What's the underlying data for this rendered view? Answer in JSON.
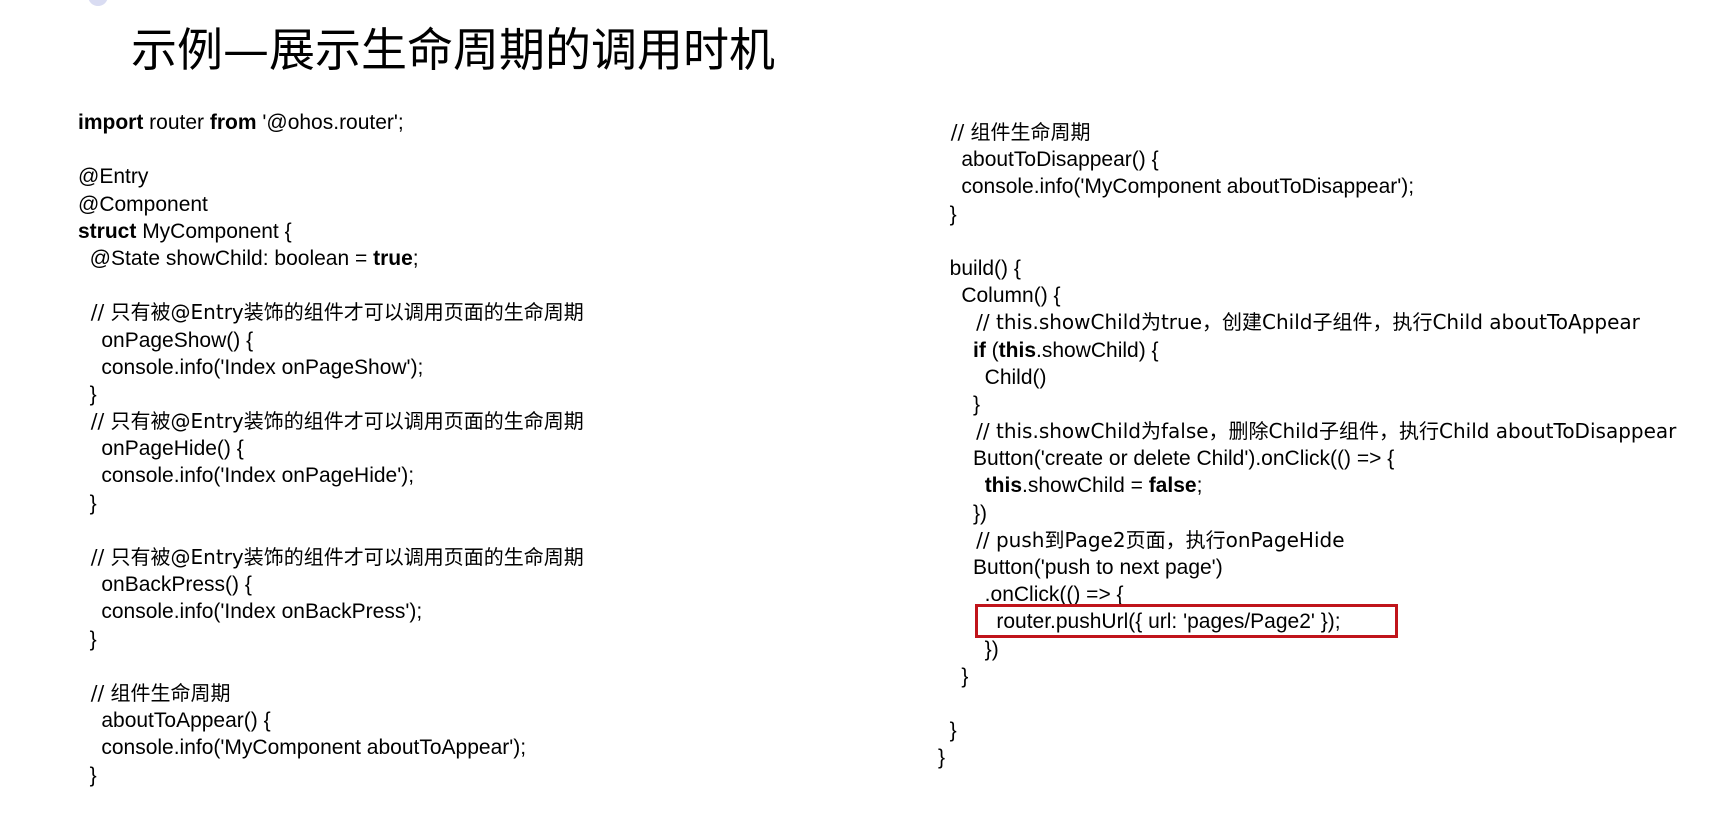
{
  "slide": {
    "title": "示例—展示生命周期的调用时机"
  },
  "code_left": [
    [
      {
        "t": "import",
        "b": true
      },
      {
        "t": " router "
      },
      {
        "t": "from",
        "b": true
      },
      {
        "t": " '@ohos.router';"
      }
    ],
    [],
    [
      {
        "t": "@Entry"
      }
    ],
    [
      {
        "t": "@Component"
      }
    ],
    [
      {
        "t": "struct",
        "b": true
      },
      {
        "t": " MyComponent {"
      }
    ],
    [
      {
        "t": "  @State showChild: boolean = "
      },
      {
        "t": "true",
        "b": true
      },
      {
        "t": ";"
      }
    ],
    [],
    [
      {
        "t": "  // 只有被@Entry装饰的组件才可以调用页面的生命周期",
        "c": true
      }
    ],
    [
      {
        "t": "    onPageShow() {"
      }
    ],
    [
      {
        "t": "    console.info('Index onPageShow');"
      }
    ],
    [
      {
        "t": "  }"
      }
    ],
    [
      {
        "t": "  // 只有被@Entry装饰的组件才可以调用页面的生命周期",
        "c": true
      }
    ],
    [
      {
        "t": "    onPageHide() {"
      }
    ],
    [
      {
        "t": "    console.info('Index onPageHide');"
      }
    ],
    [
      {
        "t": "  }"
      }
    ],
    [],
    [
      {
        "t": "  // 只有被@Entry装饰的组件才可以调用页面的生命周期",
        "c": true
      }
    ],
    [
      {
        "t": "    onBackPress() {"
      }
    ],
    [
      {
        "t": "    console.info('Index onBackPress');"
      }
    ],
    [
      {
        "t": "  }"
      }
    ],
    [],
    [
      {
        "t": "  // 组件生命周期",
        "c": true
      }
    ],
    [
      {
        "t": "    aboutToAppear() {"
      }
    ],
    [
      {
        "t": "    console.info('MyComponent aboutToAppear');"
      }
    ],
    [
      {
        "t": "  }"
      }
    ]
  ],
  "code_right": [
    [
      {
        "t": "  // 组件生命周期",
        "c": true
      }
    ],
    [
      {
        "t": "    aboutToDisappear() {"
      }
    ],
    [
      {
        "t": "    console.info('MyComponent aboutToDisappear');"
      }
    ],
    [
      {
        "t": "  }"
      }
    ],
    [],
    [
      {
        "t": "  build() {"
      }
    ],
    [
      {
        "t": "    Column() {"
      }
    ],
    [
      {
        "t": "      // this.showChild为true，创建Child子组件，执行Child aboutToAppear",
        "c": true
      }
    ],
    [
      {
        "t": "      "
      },
      {
        "t": "if",
        "b": true
      },
      {
        "t": " ("
      },
      {
        "t": "this",
        "b": true
      },
      {
        "t": ".showChild) {"
      }
    ],
    [
      {
        "t": "        Child()"
      }
    ],
    [
      {
        "t": "      }"
      }
    ],
    [
      {
        "t": "      // this.showChild为false，删除Child子组件，执行Child aboutToDisappear",
        "c": true
      }
    ],
    [
      {
        "t": "      Button('create or delete Child').onClick(() => {"
      }
    ],
    [
      {
        "t": "        "
      },
      {
        "t": "this",
        "b": true
      },
      {
        "t": ".showChild = "
      },
      {
        "t": "false",
        "b": true
      },
      {
        "t": ";"
      }
    ],
    [
      {
        "t": "      })"
      }
    ],
    [
      {
        "t": "      // push到Page2页面，执行onPageHide",
        "c": true
      }
    ],
    [
      {
        "t": "      Button('push to next page')"
      }
    ],
    [
      {
        "t": "        .onClick(() => {"
      }
    ],
    [
      {
        "t": "          router.pushUrl({ url: 'pages/Page2' });"
      }
    ],
    [
      {
        "t": "        })"
      }
    ],
    [
      {
        "t": "    }"
      }
    ],
    [],
    [
      {
        "t": "  }"
      }
    ],
    [
      {
        "t": "}"
      }
    ]
  ],
  "colors": {
    "highlight_border": "#c0141b",
    "text": "#000000"
  }
}
